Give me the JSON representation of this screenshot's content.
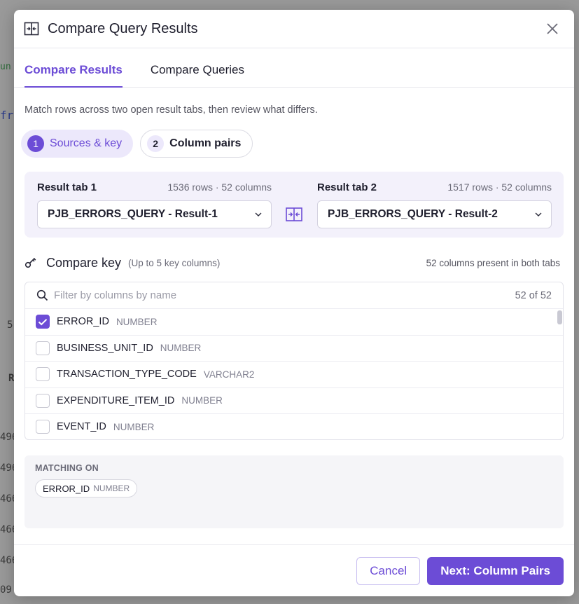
{
  "background": {
    "fragments": [
      "un",
      "fr",
      "5",
      "R",
      "496",
      "496",
      "466",
      "466",
      "466",
      "09"
    ]
  },
  "modal": {
    "title": "Compare Query Results",
    "title_icon": "compare-columns-icon",
    "close_icon": "close-icon"
  },
  "tabs": [
    {
      "label": "Compare Results",
      "active": true
    },
    {
      "label": "Compare Queries",
      "active": false
    }
  ],
  "intro": "Match rows across two open result tabs, then review what differs.",
  "steps": [
    {
      "num": "1",
      "label": "Sources & key",
      "active": true
    },
    {
      "num": "2",
      "label": "Column pairs",
      "active": false
    }
  ],
  "sources": {
    "left": {
      "label": "Result tab 1",
      "meta": "1536 rows · 52 columns",
      "selected": "PJB_ERRORS_QUERY - Result-1"
    },
    "right": {
      "label": "Result tab 2",
      "meta": "1517 rows · 52 columns",
      "selected": "PJB_ERRORS_QUERY - Result-2"
    },
    "swap_icon": "swap-icon"
  },
  "compare_key": {
    "title": "Compare key",
    "hint": "(Up to 5 key columns)",
    "count": "52 columns present in both tabs",
    "filter_placeholder": "Filter by columns by name",
    "filter_count": "52 of 52",
    "columns": [
      {
        "name": "ERROR_ID",
        "type": "NUMBER",
        "checked": true
      },
      {
        "name": "BUSINESS_UNIT_ID",
        "type": "NUMBER",
        "checked": false
      },
      {
        "name": "TRANSACTION_TYPE_CODE",
        "type": "VARCHAR2",
        "checked": false
      },
      {
        "name": "EXPENDITURE_ITEM_ID",
        "type": "NUMBER",
        "checked": false
      },
      {
        "name": "EVENT_ID",
        "type": "NUMBER",
        "checked": false
      }
    ]
  },
  "matching": {
    "label": "MATCHING ON",
    "chips": [
      {
        "name": "ERROR_ID",
        "type": "NUMBER"
      }
    ]
  },
  "footer": {
    "cancel": "Cancel",
    "next": "Next: Column Pairs"
  },
  "colors": {
    "accent": "#6c4cd6",
    "accent_soft": "#ece8fb"
  }
}
